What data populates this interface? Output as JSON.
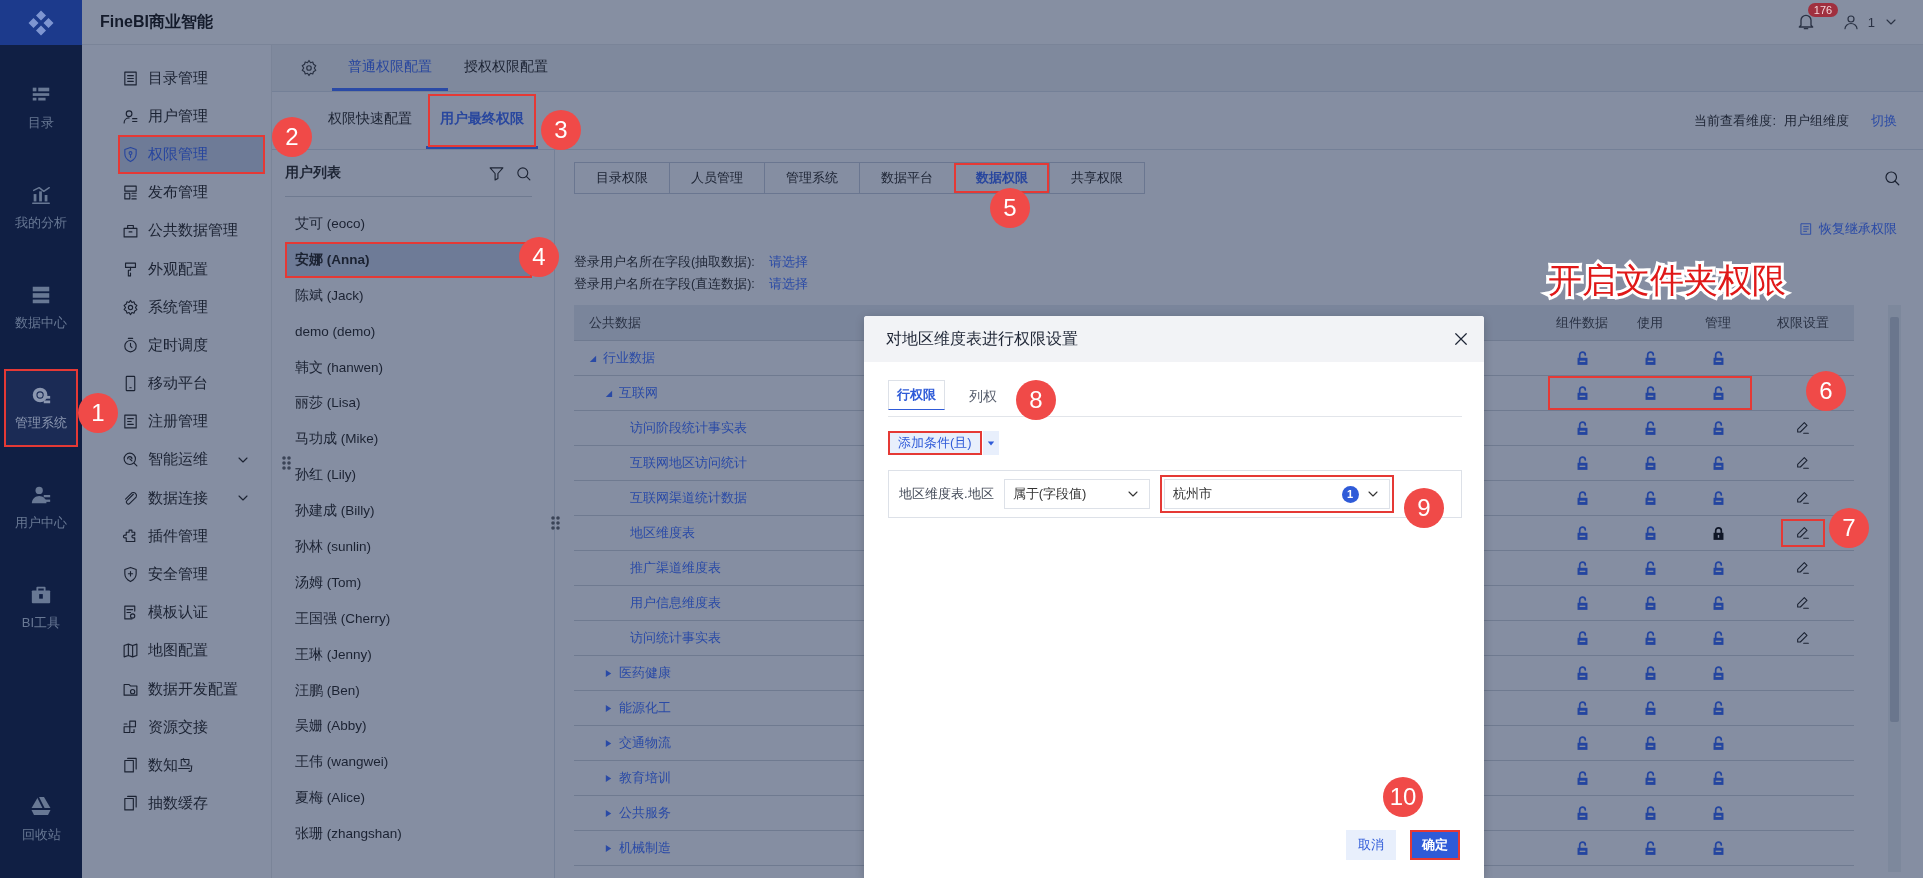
{
  "app": {
    "title": "FineBI商业智能"
  },
  "header": {
    "notification_count": "176",
    "user": "1"
  },
  "rail": {
    "items": [
      {
        "label": "目录",
        "selected": false,
        "highlighted": false
      },
      {
        "label": "我的分析",
        "selected": false,
        "highlighted": false
      },
      {
        "label": "数据中心",
        "selected": false,
        "highlighted": false
      },
      {
        "label": "管理系统",
        "selected": true,
        "highlighted": true
      },
      {
        "label": "用户中心",
        "selected": false,
        "highlighted": false
      },
      {
        "label": "BI工具",
        "selected": false,
        "highlighted": false
      }
    ],
    "footer": {
      "label": "回收站"
    }
  },
  "nav": [
    {
      "label": "目录管理",
      "kind": "link",
      "selected": false,
      "highlighted": false
    },
    {
      "label": "用户管理",
      "kind": "link",
      "selected": false,
      "highlighted": false
    },
    {
      "label": "权限管理",
      "kind": "link",
      "selected": true,
      "highlighted": true
    },
    {
      "label": "发布管理",
      "kind": "link",
      "selected": false,
      "highlighted": false
    },
    {
      "label": "公共数据管理",
      "kind": "link",
      "selected": false,
      "highlighted": false
    },
    {
      "label": "外观配置",
      "kind": "link",
      "selected": false,
      "highlighted": false
    },
    {
      "label": "系统管理",
      "kind": "link",
      "selected": false,
      "highlighted": false
    },
    {
      "label": "定时调度",
      "kind": "link",
      "selected": false,
      "highlighted": false
    },
    {
      "label": "移动平台",
      "kind": "link",
      "selected": false,
      "highlighted": false
    },
    {
      "label": "注册管理",
      "kind": "link",
      "selected": false,
      "highlighted": false
    },
    {
      "label": "智能运维",
      "kind": "group",
      "selected": false,
      "highlighted": false
    },
    {
      "label": "数据连接",
      "kind": "group",
      "selected": false,
      "highlighted": false
    },
    {
      "label": "插件管理",
      "kind": "link",
      "selected": false,
      "highlighted": false
    },
    {
      "label": "安全管理",
      "kind": "link",
      "selected": false,
      "highlighted": false
    },
    {
      "label": "模板认证",
      "kind": "link",
      "selected": false,
      "highlighted": false
    },
    {
      "label": "地图配置",
      "kind": "link",
      "selected": false,
      "highlighted": false
    },
    {
      "label": "数据开发配置",
      "kind": "link",
      "selected": false,
      "highlighted": false
    },
    {
      "label": "资源交接",
      "kind": "link",
      "selected": false,
      "highlighted": false
    },
    {
      "label": "数知鸟",
      "kind": "link",
      "selected": false,
      "highlighted": false
    },
    {
      "label": "抽数缓存",
      "kind": "link",
      "selected": false,
      "highlighted": false
    }
  ],
  "top_tabs": [
    {
      "label": "普通权限配置",
      "selected": true
    },
    {
      "label": "授权权限配置",
      "selected": false
    }
  ],
  "sub_tabs": [
    {
      "label": "权限快速配置",
      "selected": false,
      "highlighted": false
    },
    {
      "label": "用户最终权限",
      "selected": true,
      "highlighted": true
    }
  ],
  "view_dimension": {
    "label": "当前查看维度:",
    "value": "用户组维度",
    "action": "切换"
  },
  "user_list": {
    "title": "用户列表",
    "users": [
      {
        "name": "艾可 (eoco)",
        "selected": false,
        "highlighted": false
      },
      {
        "name": "安娜 (Anna)",
        "selected": true,
        "highlighted": true
      },
      {
        "name": "陈斌 (Jack)",
        "selected": false,
        "highlighted": false
      },
      {
        "name": "demo (demo)",
        "selected": false,
        "highlighted": false
      },
      {
        "name": "韩文 (hanwen)",
        "selected": false,
        "highlighted": false
      },
      {
        "name": "丽莎 (Lisa)",
        "selected": false,
        "highlighted": false
      },
      {
        "name": "马功成 (Mike)",
        "selected": false,
        "highlighted": false
      },
      {
        "name": "孙红 (Lily)",
        "selected": false,
        "highlighted": false
      },
      {
        "name": "孙建成 (Billy)",
        "selected": false,
        "highlighted": false
      },
      {
        "name": "孙林 (sunlin)",
        "selected": false,
        "highlighted": false
      },
      {
        "name": "汤姆 (Tom)",
        "selected": false,
        "highlighted": false
      },
      {
        "name": "王国强 (Cherry)",
        "selected": false,
        "highlighted": false
      },
      {
        "name": "王琳 (Jenny)",
        "selected": false,
        "highlighted": false
      },
      {
        "name": "汪鹏 (Ben)",
        "selected": false,
        "highlighted": false
      },
      {
        "name": "吴姗 (Abby)",
        "selected": false,
        "highlighted": false
      },
      {
        "name": "王伟 (wangwei)",
        "selected": false,
        "highlighted": false
      },
      {
        "name": "夏梅 (Alice)",
        "selected": false,
        "highlighted": false
      },
      {
        "name": "张珊 (zhangshan)",
        "selected": false,
        "highlighted": false
      }
    ]
  },
  "perm_tabs": [
    {
      "label": "目录权限",
      "selected": false,
      "highlighted": false
    },
    {
      "label": "人员管理",
      "selected": false,
      "highlighted": false
    },
    {
      "label": "管理系统",
      "selected": false,
      "highlighted": false
    },
    {
      "label": "数据平台",
      "selected": false,
      "highlighted": false
    },
    {
      "label": "数据权限",
      "selected": true,
      "highlighted": true
    },
    {
      "label": "共享权限",
      "selected": false,
      "highlighted": false
    }
  ],
  "restore_action": "恢复继承权限",
  "login_fields": [
    {
      "label": "登录用户名所在字段(抽取数据):",
      "link": "请选择"
    },
    {
      "label": "登录用户名所在字段(直连数据):",
      "link": "请选择"
    }
  ],
  "table": {
    "columns": [
      "公共数据",
      "组件数据",
      "使用",
      "管理",
      "权限设置"
    ],
    "rows": [
      {
        "name": "行业数据",
        "expanded": true,
        "locks": [
          false,
          false,
          false
        ],
        "editable": false,
        "locks_highlighted": false,
        "edit_highlighted": false,
        "children": [
          {
            "name": "互联网",
            "expanded": true,
            "locks": [
              false,
              false,
              false
            ],
            "editable": false,
            "locks_highlighted": true,
            "edit_highlighted": false,
            "children": [
              {
                "name": "访问阶段统计事实表",
                "locks": [
                  false,
                  false,
                  false
                ],
                "editable": true,
                "locks_highlighted": false,
                "edit_highlighted": false
              },
              {
                "name": "互联网地区访问统计",
                "locks": [
                  false,
                  false,
                  false
                ],
                "editable": true,
                "locks_highlighted": false,
                "edit_highlighted": false
              },
              {
                "name": "互联网渠道统计数据",
                "locks": [
                  false,
                  false,
                  false
                ],
                "editable": true,
                "locks_highlighted": false,
                "edit_highlighted": false
              },
              {
                "name": "地区维度表",
                "locks": [
                  false,
                  false,
                  true
                ],
                "editable": true,
                "locks_highlighted": false,
                "edit_highlighted": true
              },
              {
                "name": "推广渠道维度表",
                "locks": [
                  false,
                  false,
                  false
                ],
                "editable": true,
                "locks_highlighted": false,
                "edit_highlighted": false
              },
              {
                "name": "用户信息维度表",
                "locks": [
                  false,
                  false,
                  false
                ],
                "editable": true,
                "locks_highlighted": false,
                "edit_highlighted": false
              },
              {
                "name": "访问统计事实表",
                "locks": [
                  false,
                  false,
                  false
                ],
                "editable": true,
                "locks_highlighted": false,
                "edit_highlighted": false
              }
            ]
          },
          {
            "name": "医药健康",
            "expanded": false,
            "locks": [
              false,
              false,
              false
            ],
            "editable": false,
            "locks_highlighted": false,
            "edit_highlighted": false
          },
          {
            "name": "能源化工",
            "expanded": false,
            "locks": [
              false,
              false,
              false
            ],
            "editable": false,
            "locks_highlighted": false,
            "edit_highlighted": false
          },
          {
            "name": "交通物流",
            "expanded": false,
            "locks": [
              false,
              false,
              false
            ],
            "editable": false,
            "locks_highlighted": false,
            "edit_highlighted": false
          },
          {
            "name": "教育培训",
            "expanded": false,
            "locks": [
              false,
              false,
              false
            ],
            "editable": false,
            "locks_highlighted": false,
            "edit_highlighted": false
          },
          {
            "name": "公共服务",
            "expanded": false,
            "locks": [
              false,
              false,
              false
            ],
            "editable": false,
            "locks_highlighted": false,
            "edit_highlighted": false
          },
          {
            "name": "机械制造",
            "expanded": false,
            "locks": [
              false,
              false,
              false
            ],
            "editable": false,
            "locks_highlighted": false,
            "edit_highlighted": false
          }
        ]
      }
    ]
  },
  "dialog": {
    "title": "对地区维度表进行权限设置",
    "tabs": [
      {
        "label": "行权限",
        "selected": true
      },
      {
        "label": "列权",
        "selected": false
      }
    ],
    "add_button": {
      "label": "添加条件(且)",
      "highlighted": true
    },
    "condition": {
      "field": "地区维度表.地区",
      "operator": "属于(字段值)",
      "value": "杭州市",
      "count": "1",
      "highlighted": true
    },
    "buttons": [
      {
        "label": "取消",
        "kind": "secondary",
        "highlighted": false
      },
      {
        "label": "确定",
        "kind": "primary",
        "highlighted": true
      }
    ]
  },
  "annotations": {
    "badges": [
      "1",
      "2",
      "3",
      "4",
      "5",
      "6",
      "7",
      "8",
      "9",
      "10"
    ],
    "note": "开启文件夹权限"
  }
}
